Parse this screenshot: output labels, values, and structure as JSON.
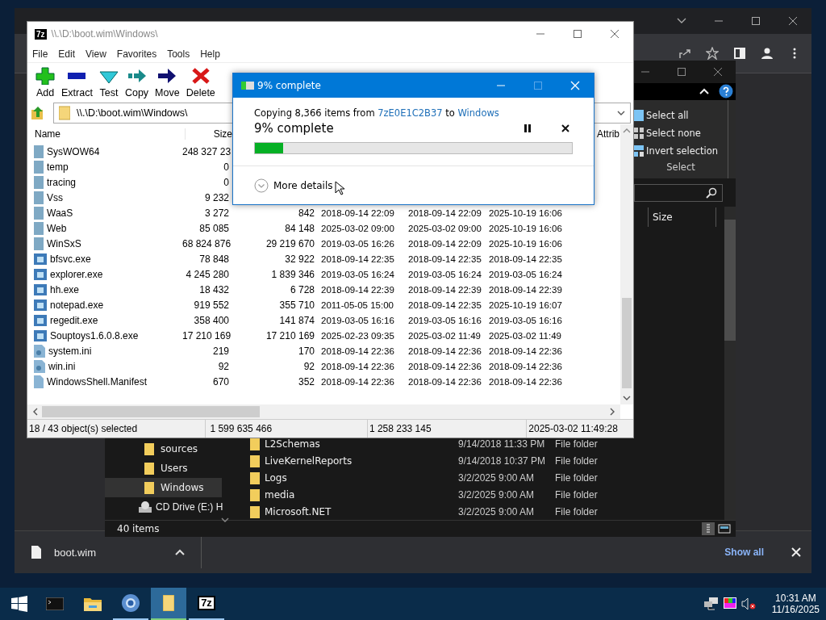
{
  "browser": {
    "download_bar": {
      "file": "boot.wim",
      "show_all": "Show all"
    }
  },
  "explorer": {
    "ribbon_items": [
      {
        "label": "Select all",
        "kind": "all"
      },
      {
        "label": "Select none",
        "kind": "none"
      },
      {
        "label": "Invert selection",
        "kind": "invert"
      }
    ],
    "ribbon_group": "Select",
    "column": "Size",
    "nav": [
      {
        "label": "sources",
        "kind": "folder",
        "selected": false
      },
      {
        "label": "Users",
        "kind": "folder",
        "selected": false
      },
      {
        "label": "Windows",
        "kind": "folder",
        "selected": true
      },
      {
        "label": "CD Drive (E:) H",
        "kind": "drive",
        "selected": false
      }
    ],
    "files": [
      {
        "name": "L2Schemas",
        "modified": "9/14/2018 11:33 PM",
        "type": "File folder"
      },
      {
        "name": "LiveKernelReports",
        "modified": "9/14/2018 10:37 PM",
        "type": "File folder"
      },
      {
        "name": "Logs",
        "modified": "3/2/2025 9:00 AM",
        "type": "File folder"
      },
      {
        "name": "media",
        "modified": "3/2/2025 9:00 AM",
        "type": "File folder"
      },
      {
        "name": "Microsoft.NET",
        "modified": "3/2/2025 9:00 AM",
        "type": "File folder"
      }
    ],
    "status": "40 items"
  },
  "sevenzip": {
    "title": "\\\\.\\D:\\boot.wim\\Windows\\",
    "logo": "7z",
    "menu": [
      "File",
      "Edit",
      "View",
      "Favorites",
      "Tools",
      "Help"
    ],
    "toolbar": [
      {
        "label": "Add",
        "kind": "add"
      },
      {
        "label": "Extract",
        "kind": "extract"
      },
      {
        "label": "Test",
        "kind": "test"
      },
      {
        "label": "Copy",
        "kind": "copy"
      },
      {
        "label": "Move",
        "kind": "move"
      },
      {
        "label": "Delete",
        "kind": "delete"
      }
    ],
    "address": "\\\\.\\D:\\boot.wim\\Windows\\",
    "columns": [
      "Name",
      "Size",
      "Attrib"
    ],
    "rows": [
      {
        "kind": "folder",
        "cells": [
          "SysWOW64",
          "248 327 23"
        ]
      },
      {
        "kind": "folder",
        "cells": [
          "temp",
          "0"
        ]
      },
      {
        "kind": "folder",
        "cells": [
          "tracing",
          "0"
        ]
      },
      {
        "kind": "folder",
        "cells": [
          "Vss",
          "9 232"
        ]
      },
      {
        "kind": "folder",
        "cells": [
          "WaaS",
          "3 272",
          "842",
          "2018-09-14 22:09",
          "2018-09-14 22:09",
          "2025-10-19 16:06"
        ]
      },
      {
        "kind": "folder",
        "cells": [
          "Web",
          "85 085",
          "84 148",
          "2025-03-02 09:00",
          "2025-03-02 09:00",
          "2025-10-19 16:06"
        ]
      },
      {
        "kind": "folder",
        "cells": [
          "WinSxS",
          "68 824 876",
          "29 219 670",
          "2019-03-05 16:26",
          "2018-09-14 22:09",
          "2025-10-19 16:06"
        ]
      },
      {
        "kind": "exe",
        "cells": [
          "bfsvc.exe",
          "78 848",
          "32 922",
          "2018-09-14 22:35",
          "2018-09-14 22:35",
          "2018-09-14 22:35"
        ]
      },
      {
        "kind": "exe",
        "cells": [
          "explorer.exe",
          "4 245 280",
          "1 839 346",
          "2019-03-05 16:24",
          "2019-03-05 16:24",
          "2019-03-05 16:24"
        ]
      },
      {
        "kind": "exe",
        "cells": [
          "hh.exe",
          "18 432",
          "6 728",
          "2018-09-14 22:39",
          "2018-09-14 22:39",
          "2018-09-14 22:39"
        ]
      },
      {
        "kind": "exe",
        "cells": [
          "notepad.exe",
          "919 552",
          "355 710",
          "2011-05-05 15:00",
          "2018-09-14 22:35",
          "2025-10-19 16:07"
        ]
      },
      {
        "kind": "exe",
        "cells": [
          "regedit.exe",
          "358 400",
          "141 874",
          "2019-03-05 16:16",
          "2019-03-05 16:16",
          "2019-03-05 16:16"
        ]
      },
      {
        "kind": "exe",
        "cells": [
          "Souptoys1.6.0.8.exe",
          "17 210 169",
          "17 210 169",
          "2025-02-23 09:35",
          "2025-03-02 11:49",
          "2025-03-02 11:49"
        ]
      },
      {
        "kind": "ini",
        "cells": [
          "system.ini",
          "219",
          "170",
          "2018-09-14 22:36",
          "2018-09-14 22:36",
          "2018-09-14 22:36"
        ]
      },
      {
        "kind": "ini",
        "cells": [
          "win.ini",
          "92",
          "92",
          "2018-09-14 22:36",
          "2018-09-14 22:36",
          "2018-09-14 22:36"
        ]
      },
      {
        "kind": "file",
        "cells": [
          "WindowsShell.Manifest",
          "670",
          "352",
          "2018-09-14 22:36",
          "2018-09-14 22:36",
          "2018-09-14 22:36"
        ]
      }
    ],
    "status": [
      "18 / 43 object(s) selected",
      "1 599 635 466",
      "1 258 233 145",
      "2025-03-02 11:49:28"
    ]
  },
  "copy_dialog": {
    "title": "9% complete",
    "copying": "Copying 8,366 items from",
    "source": "7zE0E1C2B37",
    "to": "to",
    "destination": "Windows",
    "heading": "9% complete",
    "level": 0.09,
    "more": "More details"
  },
  "taskbar": {
    "apps": [
      {
        "kind": "cmd",
        "running": false,
        "selected": false
      },
      {
        "kind": "files",
        "running": false,
        "selected": false
      },
      {
        "kind": "browser",
        "running": true,
        "selected": false
      },
      {
        "kind": "explorer",
        "running": true,
        "selected": true
      },
      {
        "kind": "sevenzip",
        "running": true,
        "selected": false,
        "label": "7z"
      }
    ],
    "time": "10:31 AM",
    "date": "11/16/2025"
  }
}
